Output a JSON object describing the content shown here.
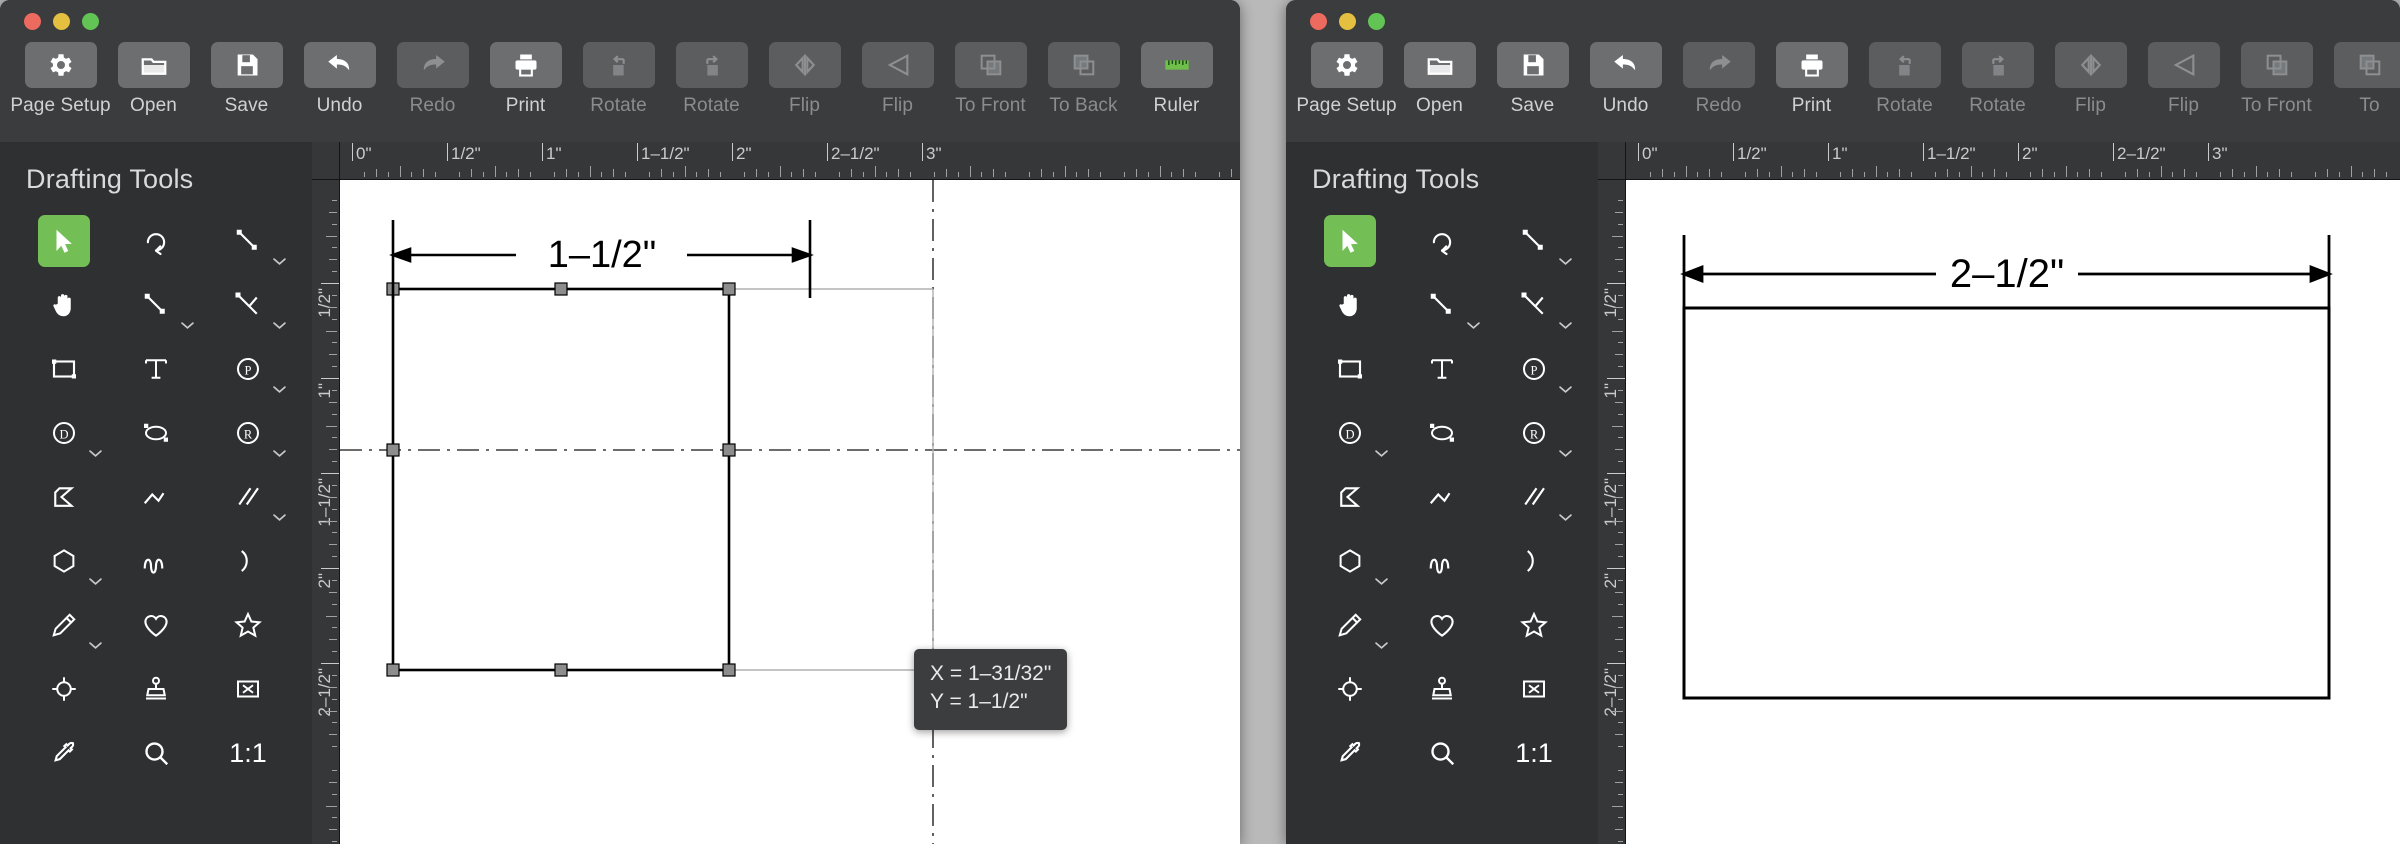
{
  "windows": [
    {
      "id": "left",
      "toolbar": {
        "buttons": [
          {
            "label": "Page Setup",
            "icon": "gear-icon",
            "enabled": true
          },
          {
            "label": "Open",
            "icon": "folder-icon",
            "enabled": true
          },
          {
            "label": "Save",
            "icon": "floppy-icon",
            "enabled": true
          },
          {
            "label": "Undo",
            "icon": "undo-arrow-icon",
            "enabled": true
          },
          {
            "label": "Redo",
            "icon": "redo-arrow-icon",
            "enabled": false
          },
          {
            "label": "Print",
            "icon": "printer-icon",
            "enabled": true
          },
          {
            "label": "Rotate",
            "icon": "rotate-left-icon",
            "enabled": false
          },
          {
            "label": "Rotate",
            "icon": "rotate-right-icon",
            "enabled": false
          },
          {
            "label": "Flip",
            "icon": "flip-horizontal-icon",
            "enabled": false
          },
          {
            "label": "Flip",
            "icon": "flip-vertical-icon",
            "enabled": false
          },
          {
            "label": "To Front",
            "icon": "bring-to-front-icon",
            "enabled": false
          },
          {
            "label": "To Back",
            "icon": "send-to-back-icon",
            "enabled": false
          },
          {
            "label": "Ruler",
            "icon": "ruler-icon",
            "enabled": true
          }
        ]
      },
      "sidebar": {
        "title": "Drafting Tools",
        "tools": [
          {
            "name": "select-arrow-tool",
            "icon": "arrow-cursor-icon",
            "selected": true,
            "caret": false
          },
          {
            "name": "rotate-tool",
            "icon": "rotate-icon",
            "selected": false,
            "caret": false
          },
          {
            "name": "measure-tool",
            "icon": "measure-icon",
            "selected": false,
            "caret": true
          },
          {
            "name": "pan-tool",
            "icon": "hand-icon",
            "selected": false,
            "caret": false
          },
          {
            "name": "line-tool",
            "icon": "line-icon",
            "selected": false,
            "caret": true
          },
          {
            "name": "angle-line-tool",
            "icon": "angle-line-icon",
            "selected": false,
            "caret": true
          },
          {
            "name": "rectangle-tool",
            "icon": "rectangle-icon",
            "selected": false,
            "caret": false
          },
          {
            "name": "text-tool",
            "icon": "text-t-icon",
            "selected": false,
            "caret": false
          },
          {
            "name": "polygon-p-tool",
            "icon": "circle-p-icon",
            "selected": false,
            "caret": true
          },
          {
            "name": "dimension-d-tool",
            "icon": "circle-d-icon",
            "selected": false,
            "caret": true
          },
          {
            "name": "ellipse-tool",
            "icon": "ellipse-icon",
            "selected": false,
            "caret": false
          },
          {
            "name": "radius-r-tool",
            "icon": "circle-r-icon",
            "selected": false,
            "caret": true
          },
          {
            "name": "chamfer-tool",
            "icon": "chamfer-icon",
            "selected": false,
            "caret": false
          },
          {
            "name": "polyline-tool",
            "icon": "polyline-icon",
            "selected": false,
            "caret": false
          },
          {
            "name": "parallel-tool",
            "icon": "parallel-lines-icon",
            "selected": false,
            "caret": true
          },
          {
            "name": "polygon-tool",
            "icon": "hexagon-icon",
            "selected": false,
            "caret": true
          },
          {
            "name": "spline-tool",
            "icon": "spline-icon",
            "selected": false,
            "caret": false
          },
          {
            "name": "arc-tool",
            "icon": "arc-icon",
            "selected": false,
            "caret": false
          },
          {
            "name": "pen-tool",
            "icon": "pen-icon",
            "selected": false,
            "caret": true
          },
          {
            "name": "heart-shape-tool",
            "icon": "heart-icon",
            "selected": false,
            "caret": false
          },
          {
            "name": "star-shape-tool",
            "icon": "star-icon",
            "selected": false,
            "caret": false
          },
          {
            "name": "target-snap-tool",
            "icon": "crosshair-icon",
            "selected": false,
            "caret": false
          },
          {
            "name": "stamp-tool",
            "icon": "stamp-icon",
            "selected": false,
            "caret": false
          },
          {
            "name": "delete-tool",
            "icon": "x-box-icon",
            "selected": false,
            "caret": false
          },
          {
            "name": "eyedropper-tool",
            "icon": "eyedropper-icon",
            "selected": false,
            "caret": false
          },
          {
            "name": "zoom-tool",
            "icon": "magnifier-icon",
            "selected": false,
            "caret": false
          },
          {
            "name": "zoom-ratio-tool",
            "icon": "ratio-text",
            "selected": false,
            "caret": false,
            "text": "1:1"
          }
        ]
      },
      "ruler": {
        "h_labels": [
          "0\"",
          "1/2\"",
          "1\"",
          "1–1/2\"",
          "2\"",
          "2–1/2\"",
          "3\""
        ],
        "v_labels": [
          "1/2\"",
          "1\"",
          "1–1/2\"",
          "2\"",
          "2–1/2\""
        ]
      },
      "canvas": {
        "dimension_label": "1–1/2\"",
        "shape": "rectangle",
        "selected": true,
        "tooltip": {
          "x_line": "X = 1–31/32\"",
          "y_line": "Y = 1–1/2\""
        }
      }
    },
    {
      "id": "right",
      "toolbar": {
        "buttons": [
          {
            "label": "Page Setup",
            "icon": "gear-icon",
            "enabled": true
          },
          {
            "label": "Open",
            "icon": "folder-icon",
            "enabled": true
          },
          {
            "label": "Save",
            "icon": "floppy-icon",
            "enabled": true
          },
          {
            "label": "Undo",
            "icon": "undo-arrow-icon",
            "enabled": true
          },
          {
            "label": "Redo",
            "icon": "redo-arrow-icon",
            "enabled": false
          },
          {
            "label": "Print",
            "icon": "printer-icon",
            "enabled": true
          },
          {
            "label": "Rotate",
            "icon": "rotate-left-icon",
            "enabled": false
          },
          {
            "label": "Rotate",
            "icon": "rotate-right-icon",
            "enabled": false
          },
          {
            "label": "Flip",
            "icon": "flip-horizontal-icon",
            "enabled": false
          },
          {
            "label": "Flip",
            "icon": "flip-vertical-icon",
            "enabled": false
          },
          {
            "label": "To Front",
            "icon": "bring-to-front-icon",
            "enabled": false
          },
          {
            "label": "To",
            "icon": "send-to-back-icon",
            "enabled": false
          }
        ]
      },
      "sidebar": {
        "title": "Drafting Tools",
        "tools": [
          {
            "name": "select-arrow-tool",
            "icon": "arrow-cursor-icon",
            "selected": true,
            "caret": false
          },
          {
            "name": "rotate-tool",
            "icon": "rotate-icon",
            "selected": false,
            "caret": false
          },
          {
            "name": "measure-tool",
            "icon": "measure-icon",
            "selected": false,
            "caret": true
          },
          {
            "name": "pan-tool",
            "icon": "hand-icon",
            "selected": false,
            "caret": false
          },
          {
            "name": "line-tool",
            "icon": "line-icon",
            "selected": false,
            "caret": true
          },
          {
            "name": "angle-line-tool",
            "icon": "angle-line-icon",
            "selected": false,
            "caret": true
          },
          {
            "name": "rectangle-tool",
            "icon": "rectangle-icon",
            "selected": false,
            "caret": false
          },
          {
            "name": "text-tool",
            "icon": "text-t-icon",
            "selected": false,
            "caret": false
          },
          {
            "name": "polygon-p-tool",
            "icon": "circle-p-icon",
            "selected": false,
            "caret": true
          },
          {
            "name": "dimension-d-tool",
            "icon": "circle-d-icon",
            "selected": false,
            "caret": true
          },
          {
            "name": "ellipse-tool",
            "icon": "ellipse-icon",
            "selected": false,
            "caret": false
          },
          {
            "name": "radius-r-tool",
            "icon": "circle-r-icon",
            "selected": false,
            "caret": true
          },
          {
            "name": "chamfer-tool",
            "icon": "chamfer-icon",
            "selected": false,
            "caret": false
          },
          {
            "name": "polyline-tool",
            "icon": "polyline-icon",
            "selected": false,
            "caret": false
          },
          {
            "name": "parallel-tool",
            "icon": "parallel-lines-icon",
            "selected": false,
            "caret": true
          },
          {
            "name": "polygon-tool",
            "icon": "hexagon-icon",
            "selected": false,
            "caret": true
          },
          {
            "name": "spline-tool",
            "icon": "spline-icon",
            "selected": false,
            "caret": false
          },
          {
            "name": "arc-tool",
            "icon": "arc-icon",
            "selected": false,
            "caret": false
          },
          {
            "name": "pen-tool",
            "icon": "pen-icon",
            "selected": false,
            "caret": true
          },
          {
            "name": "heart-shape-tool",
            "icon": "heart-icon",
            "selected": false,
            "caret": false
          },
          {
            "name": "star-shape-tool",
            "icon": "star-icon",
            "selected": false,
            "caret": false
          },
          {
            "name": "target-snap-tool",
            "icon": "crosshair-icon",
            "selected": false,
            "caret": false
          },
          {
            "name": "stamp-tool",
            "icon": "stamp-icon",
            "selected": false,
            "caret": false
          },
          {
            "name": "delete-tool",
            "icon": "x-box-icon",
            "selected": false,
            "caret": false
          },
          {
            "name": "eyedropper-tool",
            "icon": "eyedropper-icon",
            "selected": false,
            "caret": false
          },
          {
            "name": "zoom-tool",
            "icon": "magnifier-icon",
            "selected": false,
            "caret": false
          },
          {
            "name": "zoom-ratio-tool",
            "icon": "ratio-text",
            "selected": false,
            "caret": false,
            "text": "1:1"
          }
        ]
      },
      "ruler": {
        "h_labels": [
          "0\"",
          "1/2\"",
          "1\"",
          "1–1/2\"",
          "2\"",
          "2–1/2\"",
          "3\""
        ],
        "v_labels": [
          "1/2\"",
          "1\"",
          "1–1/2\"",
          "2\"",
          "2–1/2\""
        ]
      },
      "canvas": {
        "dimension_label": "2–1/2\"",
        "shape": "rectangle",
        "selected": false,
        "tooltip": null
      }
    }
  ],
  "colors": {
    "accent_green": "#73bf56",
    "toolbar_bg": "#3a3c3e",
    "sidebar_bg": "#2e3032",
    "canvas_bg": "#ffffff",
    "traffic_red": "#ed6a5e",
    "traffic_yellow": "#e4bf40",
    "traffic_green": "#61c454"
  }
}
